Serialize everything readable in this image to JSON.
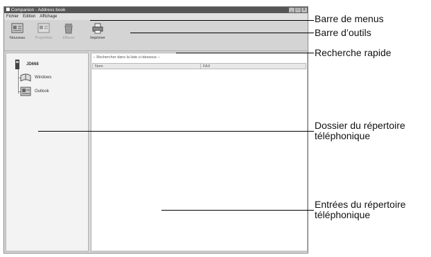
{
  "window": {
    "title": "Companion - Address book",
    "controls": [
      "_",
      "□",
      "x"
    ]
  },
  "menubar": {
    "items": [
      "Fichier",
      "Edition",
      "Affichage"
    ]
  },
  "toolbar": {
    "buttons": [
      {
        "label": "Nouveau",
        "enabled": true,
        "icon": "address-card-icon"
      },
      {
        "label": "Propriétés",
        "enabled": false,
        "icon": "properties-icon"
      },
      {
        "label": "Effacer",
        "enabled": false,
        "icon": "trash-icon"
      },
      {
        "label": "Imprimer",
        "enabled": true,
        "icon": "printer-icon"
      }
    ]
  },
  "sidebar": {
    "items": [
      {
        "label": "JD668",
        "icon": "phone-device-icon"
      },
      {
        "label": "Windows",
        "icon": "book-icon"
      },
      {
        "label": "Outlook",
        "icon": "outlook-icon"
      }
    ]
  },
  "main": {
    "search_placeholder": "-- Rechercher dans la liste ci-dessous --",
    "columns": [
      "Nom",
      "FAX"
    ]
  },
  "callouts": {
    "menubar": "Barre de menus",
    "toolbar": "Barre d’outils",
    "search": "Recherche rapide",
    "folder_line1": "Dossier du répertoire",
    "folder_line2": "téléphonique",
    "entries_line1": "Entrées du répertoire",
    "entries_line2": "téléphonique"
  }
}
